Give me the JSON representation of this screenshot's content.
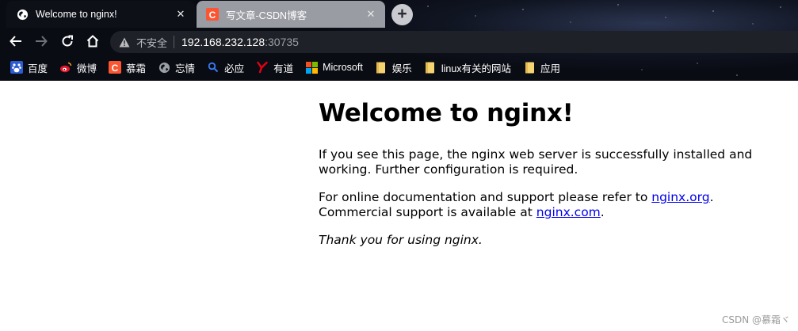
{
  "tabs": [
    {
      "title": "Welcome to nginx!",
      "close": "✕"
    },
    {
      "title": "写文章-CSDN博客",
      "close": "✕"
    }
  ],
  "new_tab_label": "+",
  "address_bar": {
    "security_label": "不安全",
    "host": "192.168.232.128",
    "port": ":30735"
  },
  "bookmarks": [
    {
      "label": "百度",
      "icon": "baidu-icon",
      "color": "#2d5bd3"
    },
    {
      "label": "微博",
      "icon": "weibo-icon",
      "color": "#e6162d"
    },
    {
      "label": "慕霜",
      "icon": "csdn-icon",
      "color": "#fc5531"
    },
    {
      "label": "忘情",
      "icon": "globe-icon",
      "color": "#9aa0a6"
    },
    {
      "label": "必应",
      "icon": "bing-search-icon",
      "color": "#3b7bf5"
    },
    {
      "label": "有道",
      "icon": "youdao-icon",
      "color": "#e60012"
    },
    {
      "label": "Microsoft",
      "icon": "microsoft-icon",
      "color": "#f25022"
    },
    {
      "label": "娱乐",
      "icon": "folder-icon",
      "color": "#f6d371"
    },
    {
      "label": "linux有关的网站",
      "icon": "folder-icon",
      "color": "#f6d371"
    },
    {
      "label": "应用",
      "icon": "folder-icon",
      "color": "#f6d371"
    }
  ],
  "page": {
    "heading": "Welcome to nginx!",
    "para1": "If you see this page, the nginx web server is successfully installed and working. Further configuration is required.",
    "para2_prefix": "For online documentation and support please refer to ",
    "link1": "nginx.org",
    "para2_mid": ".",
    "para2_line2": "Commercial support is available at ",
    "link2": "nginx.com",
    "para2_end": ".",
    "thanks": "Thank you for using nginx."
  },
  "watermark": "CSDN @慕霜ヾ"
}
